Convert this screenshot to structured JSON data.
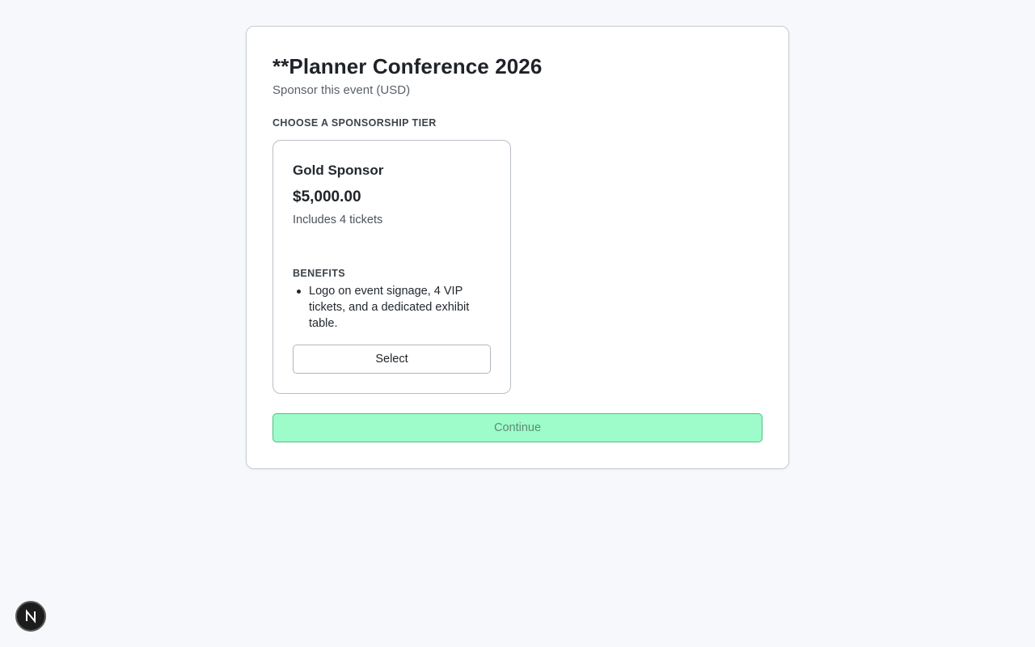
{
  "event": {
    "title": "**Planner Conference 2026",
    "subtitle": "Sponsor this event (USD)"
  },
  "tier_section": {
    "label": "CHOOSE A SPONSORSHIP TIER",
    "tiers": [
      {
        "name": "Gold Sponsor",
        "price": "$5,000.00",
        "tickets": "Includes 4 tickets",
        "benefits_label": "BENEFITS",
        "benefits": [
          "Logo on event signage, 4 VIP tickets, and a dedicated exhibit table."
        ],
        "select_label": "Select"
      }
    ]
  },
  "actions": {
    "continue_label": "Continue",
    "continue_disabled": true
  },
  "floating_badge": {
    "icon": "n-logo-icon"
  },
  "colors": {
    "continue_bg": "#9dfcc9",
    "continue_border": "#4fbf86",
    "page_bg": "#f7f8fc"
  }
}
